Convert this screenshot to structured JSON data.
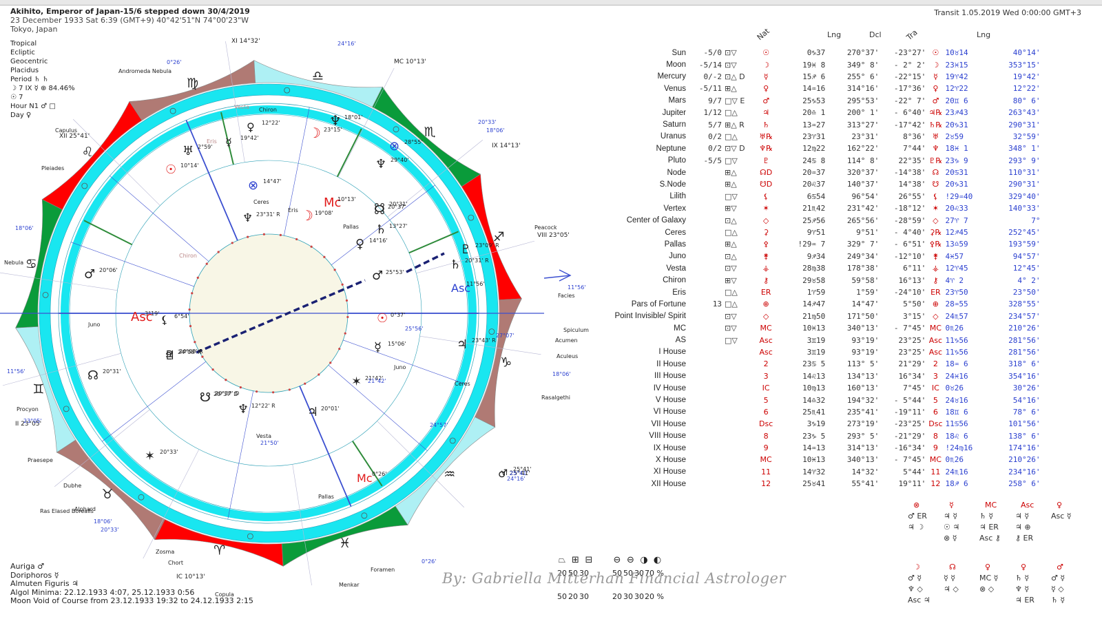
{
  "header": {
    "title": "Akihito, Emperor of Japan-15/6 stepped down 30/4/2019",
    "date_line": "23 December 1933  Sat   6:39 (GMT+9) 40°42'51\"N  74°00'23\"W",
    "place": "Tokyo, Japan"
  },
  "system": {
    "lines": [
      "Tropical",
      "Ecliptic",
      "Geocentric",
      "Placidus"
    ],
    "period_label": "Period",
    "period_glyphs": "♄ ♄",
    "moon_line": "☽  7 IX ☿ ⊕ 84.46%",
    "sun_line": "☉  7",
    "hour": "Hour N1 ♂ □",
    "day": "Day ♀"
  },
  "transit": "Transit  1.05.2019  Wed  0:00:00 GMT+3",
  "table": {
    "col_nat": "Nat",
    "col_lng": "Lng",
    "col_dcl": "Dcl",
    "col_tra": "Tra",
    "col_tlng": "Lng",
    "rows": [
      {
        "name": "Sun",
        "dig": "-5/0",
        "asp": "⊡▽",
        "g": "☉",
        "pos": "0♑37",
        "lng": "270°37'",
        "dcl": "-23°27'",
        "tg": "☉",
        "tpos": "10♉14",
        "tlng": "40°14'"
      },
      {
        "name": "Moon",
        "dig": "-5/14",
        "asp": "⊡▽",
        "g": "☽",
        "pos": "19♓ 8",
        "lng": "349° 8'",
        "dcl": "- 2° 2'",
        "tg": "☽",
        "tpos": "23♓15",
        "tlng": "353°15'"
      },
      {
        "name": "Mercury",
        "dig": "0/-2",
        "asp": "⊡△ D",
        "g": "☿",
        "pos": "15♐ 6",
        "lng": "255° 6'",
        "dcl": "-22°15'",
        "tg": "☿",
        "tpos": "19♈42",
        "tlng": "19°42'"
      },
      {
        "name": "Venus",
        "dig": "-5/11",
        "asp": "⊞△",
        "g": "♀",
        "pos": "14♒16",
        "lng": "314°16'",
        "dcl": "-17°36'",
        "tg": "♀",
        "tpos": "12♈22",
        "tlng": "12°22'"
      },
      {
        "name": "Mars",
        "dig": "9/7",
        "asp": "□▽ E",
        "g": "♂",
        "pos": "25♑53",
        "lng": "295°53'",
        "dcl": "-22° 7'",
        "tg": "♂",
        "tpos": "20♊ 6",
        "tlng": "80° 6'"
      },
      {
        "name": "Jupiter",
        "dig": "1/12",
        "asp": "□△",
        "g": "♃",
        "pos": "20♎ 1",
        "lng": "200° 1'",
        "dcl": "- 6°40'",
        "tg": "♃℞",
        "tpos": "23♐43",
        "tlng": "263°43'"
      },
      {
        "name": "Saturn",
        "dig": "5/7",
        "asp": "⊞△ R",
        "g": "♄",
        "pos": "13♒27",
        "lng": "313°27'",
        "dcl": "-17°42'",
        "tg": "♄℞",
        "tpos": "20♑31",
        "tlng": "290°31'"
      },
      {
        "name": "Uranus",
        "dig": "0/2",
        "asp": "□△",
        "g": "♅℞",
        "pos": "23♈31",
        "lng": "23°31'",
        "dcl": "8°36'",
        "tg": "♅",
        "tpos": "2♉59",
        "tlng": "32°59'"
      },
      {
        "name": "Neptune",
        "dig": "0/2",
        "asp": "⊡▽ D",
        "g": "♆℞",
        "pos": "12♍22",
        "lng": "162°22'",
        "dcl": "7°44'",
        "tg": "♆",
        "tpos": "18♓ 1",
        "tlng": "348° 1'"
      },
      {
        "name": "Pluto",
        "dig": "-5/5",
        "asp": "□▽",
        "g": "♇",
        "pos": "24♋ 8",
        "lng": "114° 8'",
        "dcl": "22°35'",
        "tg": "♇℞",
        "tpos": "23♑ 9",
        "tlng": "293° 9'"
      },
      {
        "name": "Node",
        "dig": "",
        "asp": "⊞△",
        "g": "☊D",
        "pos": "20♒37",
        "lng": "320°37'",
        "dcl": "-14°38'",
        "tg": "☊",
        "tpos": "20♋31",
        "tlng": "110°31'"
      },
      {
        "name": "S.Node",
        "dig": "",
        "asp": "⊞△",
        "g": "☋D",
        "pos": "20♌37",
        "lng": "140°37'",
        "dcl": "14°38'",
        "tg": "☋",
        "tpos": "20♑31",
        "tlng": "290°31'"
      },
      {
        "name": "Lilith",
        "dig": "",
        "asp": "□▽",
        "g": "⚸",
        "pos": "6♋54",
        "lng": "96°54'",
        "dcl": "26°55'",
        "tg": "⚸",
        "tpos": "!29♒40",
        "tlng": "329°40'"
      },
      {
        "name": "Vertex",
        "dig": "",
        "asp": "⊞▽",
        "g": "✶",
        "pos": "21♏42",
        "lng": "231°42'",
        "dcl": "-18°12'",
        "tg": "✶",
        "tpos": "20♌33",
        "tlng": "140°33'"
      },
      {
        "name": "Center of Galaxy",
        "dig": "",
        "asp": "⊡△",
        "g": "◇",
        "pos": "25♐56",
        "lng": "265°56'",
        "dcl": "-28°59'",
        "tg": "◇",
        "tpos": "27♈ 7",
        "tlng": "7°"
      },
      {
        "name": "Ceres",
        "dig": "",
        "asp": "□△",
        "g": "⚳",
        "pos": "9♈51",
        "lng": "9°51'",
        "dcl": "- 4°40'",
        "tg": "⚳℞",
        "tpos": "12♐45",
        "tlng": "252°45'"
      },
      {
        "name": "Pallas",
        "dig": "",
        "asp": "⊞△",
        "g": "⚴",
        "pos": "!29♒ 7",
        "lng": "329° 7'",
        "dcl": "- 6°51'",
        "tg": "⚴℞",
        "tpos": "13♎59",
        "tlng": "193°59'"
      },
      {
        "name": "Juno",
        "dig": "",
        "asp": "⊡△",
        "g": "⚵",
        "pos": "9♐34",
        "lng": "249°34'",
        "dcl": "-12°10'",
        "tg": "⚵",
        "tpos": "4♓57",
        "tlng": "94°57'"
      },
      {
        "name": "Vesta",
        "dig": "",
        "asp": "⊡▽",
        "g": "⚶",
        "pos": "28♍38",
        "lng": "178°38'",
        "dcl": "6°11'",
        "tg": "⚶",
        "tpos": "12♈45",
        "tlng": "12°45'"
      },
      {
        "name": "Chiron",
        "dig": "",
        "asp": "⊞▽",
        "g": "⚷",
        "pos": "29♉58",
        "lng": "59°58'",
        "dcl": "16°13'",
        "tg": "⚷",
        "tpos": "4♈ 2",
        "tlng": "4° 2'"
      },
      {
        "name": "Eris",
        "dig": "",
        "asp": "□△",
        "g": "ER",
        "pos": "1♈59",
        "lng": "1°59'",
        "dcl": "-24°10'",
        "tg": "ER",
        "tpos": "23♈50",
        "tlng": "23°50'"
      },
      {
        "name": "Pars of Fortune",
        "dig": "13",
        "asp": "□△",
        "g": "⊕",
        "pos": "14♐47",
        "lng": "14°47'",
        "dcl": "5°50'",
        "tg": "⊕",
        "tpos": "28♒55",
        "tlng": "328°55'"
      },
      {
        "name": "Point Invisible/ Spirit",
        "dig": "",
        "asp": "⊡▽",
        "g": "◇",
        "pos": "21♍50",
        "lng": "171°50'",
        "dcl": "3°15'",
        "tg": "◇",
        "tpos": "24♏57",
        "tlng": "234°57'"
      },
      {
        "name": "MC",
        "dig": "",
        "asp": "⊡▽",
        "g": "MC",
        "pos": "10♓13",
        "lng": "340°13'",
        "dcl": "- 7°45'",
        "tg": "MC",
        "tpos": "0♏26",
        "tlng": "210°26'"
      },
      {
        "name": "AS",
        "dig": "",
        "asp": "□▽",
        "g": "Asc",
        "pos": "3♊19",
        "lng": "93°19'",
        "dcl": "23°25'",
        "tg": "Asc",
        "tpos": "11♑56",
        "tlng": "281°56'"
      },
      {
        "name": "I House",
        "dig": "",
        "asp": "",
        "g": "Asc",
        "pos": "3♊19",
        "lng": "93°19'",
        "dcl": "23°25'",
        "tg": "Asc",
        "tpos": "11♑56",
        "tlng": "281°56'"
      },
      {
        "name": "II House",
        "dig": "",
        "asp": "",
        "g": "2",
        "pos": "23♋ 5",
        "lng": "113° 5'",
        "dcl": "21°29'",
        "tg": "2",
        "tpos": "18♒ 6",
        "tlng": "318° 6'"
      },
      {
        "name": "III House",
        "dig": "",
        "asp": "",
        "g": "3",
        "pos": "14♌13",
        "lng": "134°13'",
        "dcl": "16°34'",
        "tg": "3",
        "tpos": "24♓16",
        "tlng": "354°16'"
      },
      {
        "name": "IV House",
        "dig": "",
        "asp": "",
        "g": "IC",
        "pos": "10♍13",
        "lng": "160°13'",
        "dcl": "7°45'",
        "tg": "IC",
        "tpos": "0♉26",
        "tlng": "30°26'"
      },
      {
        "name": "V House",
        "dig": "",
        "asp": "",
        "g": "5",
        "pos": "14♎32",
        "lng": "194°32'",
        "dcl": "- 5°44'",
        "tg": "5",
        "tpos": "24♉16",
        "tlng": "54°16'"
      },
      {
        "name": "VI House",
        "dig": "",
        "asp": "",
        "g": "6",
        "pos": "25♏41",
        "lng": "235°41'",
        "dcl": "-19°11'",
        "tg": "6",
        "tpos": "18♊ 6",
        "tlng": "78° 6'"
      },
      {
        "name": "VII House",
        "dig": "",
        "asp": "",
        "g": "Dsc",
        "pos": "3♑19",
        "lng": "273°19'",
        "dcl": "-23°25'",
        "tg": "Dsc",
        "tpos": "11♋56",
        "tlng": "101°56'"
      },
      {
        "name": "VIII House",
        "dig": "",
        "asp": "",
        "g": "8",
        "pos": "23♑ 5",
        "lng": "293° 5'",
        "dcl": "-21°29'",
        "tg": "8",
        "tpos": "18♌ 6",
        "tlng": "138° 6'"
      },
      {
        "name": "IX House",
        "dig": "",
        "asp": "",
        "g": "9",
        "pos": "14♒13",
        "lng": "314°13'",
        "dcl": "-16°34'",
        "tg": "9",
        "tpos": "!24♍16",
        "tlng": "174°16'"
      },
      {
        "name": "X House",
        "dig": "",
        "asp": "",
        "g": "MC",
        "pos": "10♓13",
        "lng": "340°13'",
        "dcl": "- 7°45'",
        "tg": "MC",
        "tpos": "0♏26",
        "tlng": "210°26'"
      },
      {
        "name": "XI House",
        "dig": "",
        "asp": "",
        "g": "11",
        "pos": "14♈32",
        "lng": "14°32'",
        "dcl": "5°44'",
        "tg": "11",
        "tpos": "24♏16",
        "tlng": "234°16'"
      },
      {
        "name": "XII House",
        "dig": "",
        "asp": "",
        "g": "12",
        "pos": "25♉41",
        "lng": "55°41'",
        "dcl": "19°11'",
        "tg": "12",
        "tpos": "18♐ 6",
        "tlng": "258° 6'"
      }
    ]
  },
  "wheel": {
    "sign_glyphs": [
      "♈",
      "♉",
      "♊",
      "♋",
      "♌",
      "♍",
      "♎",
      "♏",
      "♐",
      "♑",
      "♒",
      "♓"
    ],
    "house_labels": [
      {
        "t": "XI 14°32'"
      },
      {
        "t": "XII 25°41'"
      },
      {
        "t": "II 23°05'"
      },
      {
        "t": "IC 10°13'"
      },
      {
        "t": "VIII 23°05'"
      },
      {
        "t": "IX 14°13'"
      },
      {
        "t": "MC 10°13'"
      },
      {
        "t": "VI 25°41'"
      }
    ],
    "natal_labels": [
      {
        "t": "Asc",
        "sub": "3°19'"
      },
      {
        "t": "Mc",
        "sub": "10°13'"
      },
      {
        "t": "♆",
        "sub": "23°31' R"
      },
      {
        "t": "☽",
        "sub": "19°08'"
      },
      {
        "t": "☊",
        "sub": "20°37'"
      },
      {
        "t": "♄",
        "sub": "13°27'"
      },
      {
        "t": "♀",
        "sub": "14°16'"
      },
      {
        "t": "♂",
        "sub": "25°53'"
      },
      {
        "t": "☉",
        "sub": "0°37'"
      },
      {
        "t": "☿",
        "sub": "15°06'"
      },
      {
        "t": "♃",
        "sub": "20°01'"
      },
      {
        "t": "♆",
        "sub": "12°22' R"
      },
      {
        "t": "☋",
        "sub": "20°37' D"
      },
      {
        "t": "♇",
        "sub": "24°08' R"
      },
      {
        "t": "⚸",
        "sub": "6°54'"
      },
      {
        "t": "✶",
        "sub": "21°42'"
      }
    ],
    "transit_labels": [
      {
        "t": "Asc",
        "sub": "11°56'"
      },
      {
        "t": "Mc",
        "sub": "0°26'"
      },
      {
        "t": "☽",
        "sub": "23°15'"
      },
      {
        "t": "♆",
        "sub": "18°01'"
      },
      {
        "t": "♃",
        "sub": "23°43' R"
      },
      {
        "t": "♄",
        "sub": "20°31' R"
      },
      {
        "t": "♇",
        "sub": "23°09' R"
      },
      {
        "t": "♂",
        "sub": "20°06'"
      },
      {
        "t": "☉",
        "sub": "10°14'"
      },
      {
        "t": "♀",
        "sub": "12°22'"
      },
      {
        "t": "☿",
        "sub": "19°42'"
      },
      {
        "t": "♅",
        "sub": "2°59'"
      },
      {
        "t": "⊗",
        "sub": "28°55'"
      },
      {
        "t": "⊗",
        "sub": "14°47'"
      },
      {
        "t": "♆",
        "sub": "29°40'"
      },
      {
        "t": "☊",
        "sub": "20°31'"
      },
      {
        "t": "☋",
        "sub": "20°37' D"
      },
      {
        "t": "☋",
        "sub": "20°31'"
      },
      {
        "t": "♃",
        "sub": "24°08' R"
      },
      {
        "t": "✶",
        "sub": "20°33'"
      },
      {
        "t": "♂",
        "sub": "25°41'"
      }
    ],
    "small_labels": [
      "Andromeda Nebula",
      "Pleiades",
      "Capulus",
      "Nebula",
      "Juno",
      "Procyon",
      "Praesepe",
      "Dubhe",
      "Ras Elased Borealis",
      "Alphard",
      "Zosma",
      "Chort",
      "Copula",
      "Foramen",
      "Acumen",
      "Aculeus",
      "Spiculum",
      "Rasalgethi",
      "Peacock",
      "Facies",
      "Ceres",
      "Pallas",
      "Vesta",
      "Chiron",
      "Eris",
      "Juno",
      "Ceres",
      "Pallas",
      "Vesta",
      "Chiron",
      "Eris",
      "Menkar"
    ],
    "degree_marks": [
      "0°26'",
      "24°16'",
      "18°06'",
      "20°33'",
      "11°56'",
      "18°06'",
      "24°16'",
      "0°26'",
      "18°06'",
      "20°33'",
      "24°57'",
      "27°07'",
      "25°56'",
      "21°50'",
      "21°42'",
      "25°41'",
      "18°06'",
      "23°05'",
      "11°56'"
    ]
  },
  "bottom": {
    "lines": [
      "Auriga ♂",
      "Doriphoros ☿",
      "Almuten Figuris ♃",
      "Algol Minima: 22.12.1933  4:07, 25.12.1933  0:56",
      "Moon Void of Course from 23.12.1933 19:32 to 24.12.1933  2:15"
    ],
    "signature": "By:  Gabriella Mitterhan Financial Astrologer",
    "pct_icons_a": [
      "⏢",
      "⊞",
      "⊟"
    ],
    "pct_vals_a1": [
      "20",
      "50",
      "30"
    ],
    "pct_vals_a2": [
      "50",
      "20",
      "30"
    ],
    "pct_icons_b": [
      "⊖",
      "⊖",
      "◑",
      "◐"
    ],
    "pct_vals_b1": [
      "50",
      "50",
      "30",
      "70 %"
    ],
    "pct_vals_b2": [
      "20",
      "30",
      "30",
      "20 %"
    ]
  },
  "asp_grid": {
    "heads": [
      "⊗",
      "☿",
      "MC",
      "Asc",
      "♀",
      "☽",
      "☊",
      "♀",
      "♀",
      "♂"
    ],
    "row1": [
      [
        "♂ ER",
        "♃ ☽"
      ],
      [
        "♃ ☿",
        "☉ ♃",
        "⊗ ☿"
      ],
      [
        "♄ ☿",
        "♃ ER",
        "Asc ⚷"
      ],
      [
        "♃ ☿",
        "♃ ⊕",
        "⚷ ER"
      ],
      [
        "Asc ☿"
      ]
    ],
    "row2": [
      [
        "♂ ☿",
        "♆ ◇",
        "Asc ♃"
      ],
      [
        "☿ ☿",
        "♃ ◇"
      ],
      [
        "MC ☿",
        "⊗ ◇"
      ],
      [
        "♄ ☿",
        "♆ ☿",
        "♃ ER"
      ],
      [
        "♂ ☿",
        "☿ ◇",
        "♄ ☿"
      ]
    ]
  },
  "colors": {
    "fire": "#ff0000",
    "earth": "#b07a74",
    "air": "#aef0f4",
    "water": "#0a9b3a",
    "cyan_ring": "#19e6f0",
    "disc": "#f8f6e6",
    "red_glyph": "#e11b1b",
    "blue_glyph": "#2a3fcf",
    "ink": "#222222"
  }
}
